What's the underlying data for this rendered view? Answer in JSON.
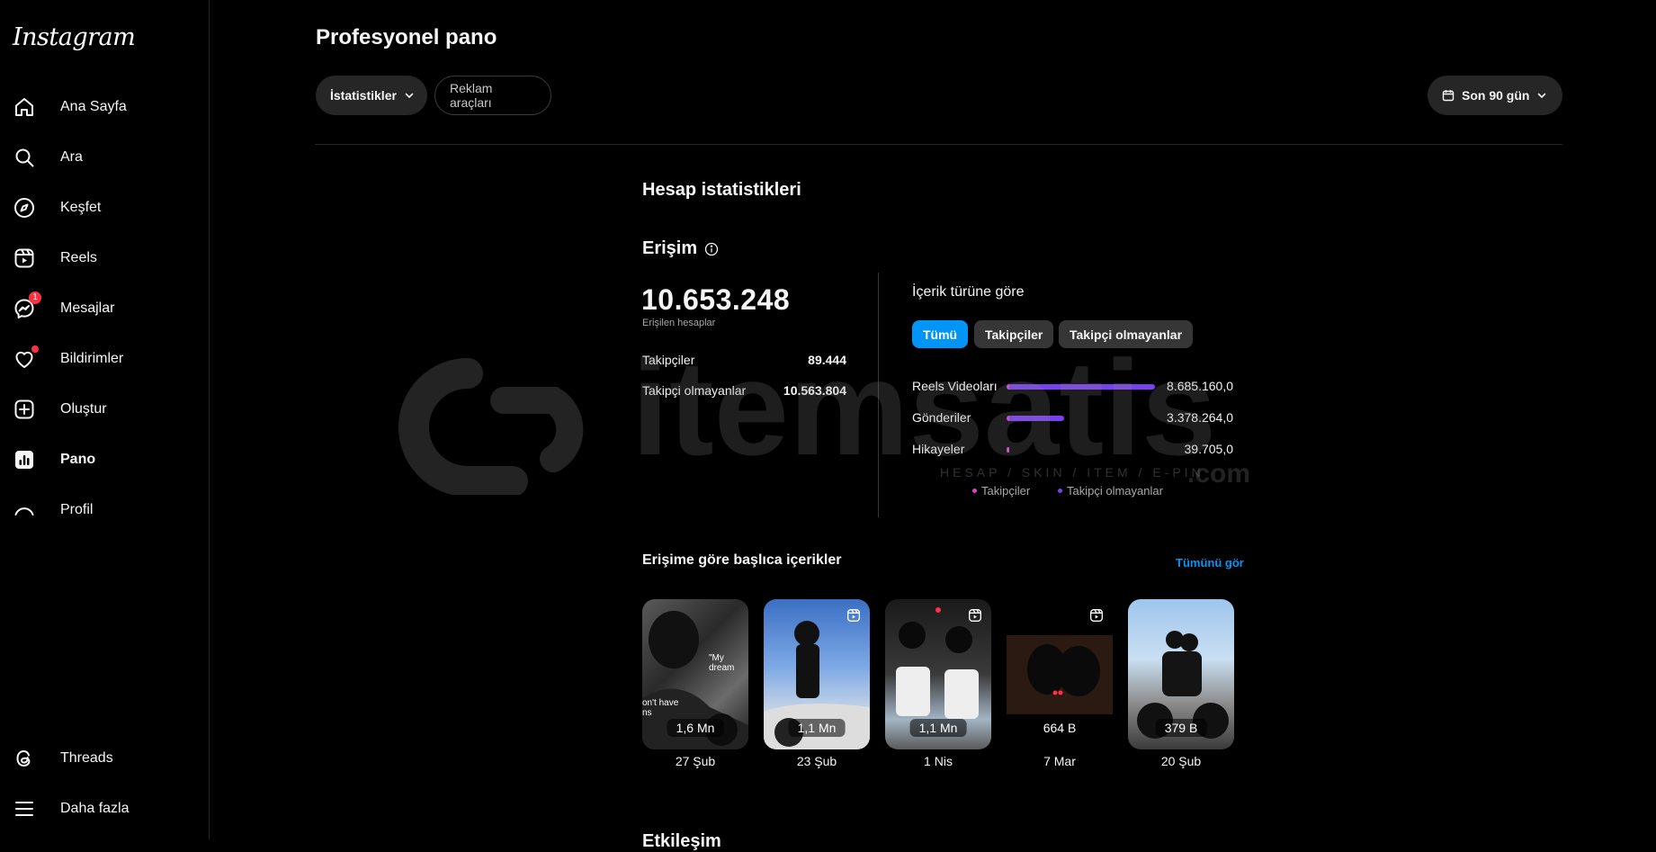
{
  "app": {
    "logo": "Instagram"
  },
  "sidebar": {
    "items": [
      {
        "label": "Ana Sayfa",
        "icon": "home-icon"
      },
      {
        "label": "Ara",
        "icon": "search-icon"
      },
      {
        "label": "Keşfet",
        "icon": "compass-icon"
      },
      {
        "label": "Reels",
        "icon": "reels-icon"
      },
      {
        "label": "Mesajlar",
        "icon": "messenger-icon",
        "badge": "1"
      },
      {
        "label": "Bildirimler",
        "icon": "heart-icon"
      },
      {
        "label": "Oluştur",
        "icon": "plus-square-icon"
      },
      {
        "label": "Pano",
        "icon": "dashboard-icon",
        "active": true
      },
      {
        "label": "Profil",
        "icon": "avatar-icon"
      },
      {
        "label": "Threads",
        "icon": "threads-icon"
      },
      {
        "label": "Daha fazla",
        "icon": "menu-icon"
      }
    ]
  },
  "header": {
    "title": "Profesyonel pano",
    "tabs": [
      "İstatistikler",
      "Reklam araçları"
    ],
    "date_range": "Son 90 gün"
  },
  "stats": {
    "section_title": "Hesap istatistikleri",
    "reach_title": "Erişim",
    "reach_value": "10.653.248",
    "reach_label": "Erişilen hesaplar",
    "rows": [
      {
        "label": "Takipçiler",
        "value": "89.444"
      },
      {
        "label": "Takipçi olmayanlar",
        "value": "10.563.804"
      }
    ]
  },
  "content_type": {
    "title": "İçerik türüne göre",
    "chips": [
      "Tümü",
      "Takipçiler",
      "Takipçi olmayanlar"
    ],
    "bars": [
      {
        "label": "Reels Videoları",
        "value": "8.685.160,0",
        "fraction": 1.0
      },
      {
        "label": "Gönderiler",
        "value": "3.378.264,0",
        "fraction": 0.39
      },
      {
        "label": "Hikayeler",
        "value": "39.705,0",
        "fraction": 0.015
      }
    ],
    "legend": [
      "Takipçiler",
      "Takipçi olmayanlar"
    ],
    "colors": {
      "followers": "#e040d8",
      "non_followers": "#7b3ff2",
      "accent": "#0095f6"
    }
  },
  "top_content": {
    "title": "Erişime göre başlıca içerikler",
    "see_all": "Tümünü gör",
    "items": [
      {
        "views": "1,6 Mn",
        "date": "27 Şub",
        "overlay_a": "\"My dream",
        "overlay_b": "on't have\nns"
      },
      {
        "views": "1,1 Mn",
        "date": "23 Şub"
      },
      {
        "views": "1,1 Mn",
        "date": "1 Nis"
      },
      {
        "views": "664 B",
        "date": "7 Mar"
      },
      {
        "views": "379 B",
        "date": "20 Şub"
      }
    ]
  },
  "next_section": "Etkileşim",
  "watermark": {
    "text": "itemsatis",
    "sub": "HESAP / SKIN / ITEM / E-PIN",
    "tld": ".com"
  }
}
